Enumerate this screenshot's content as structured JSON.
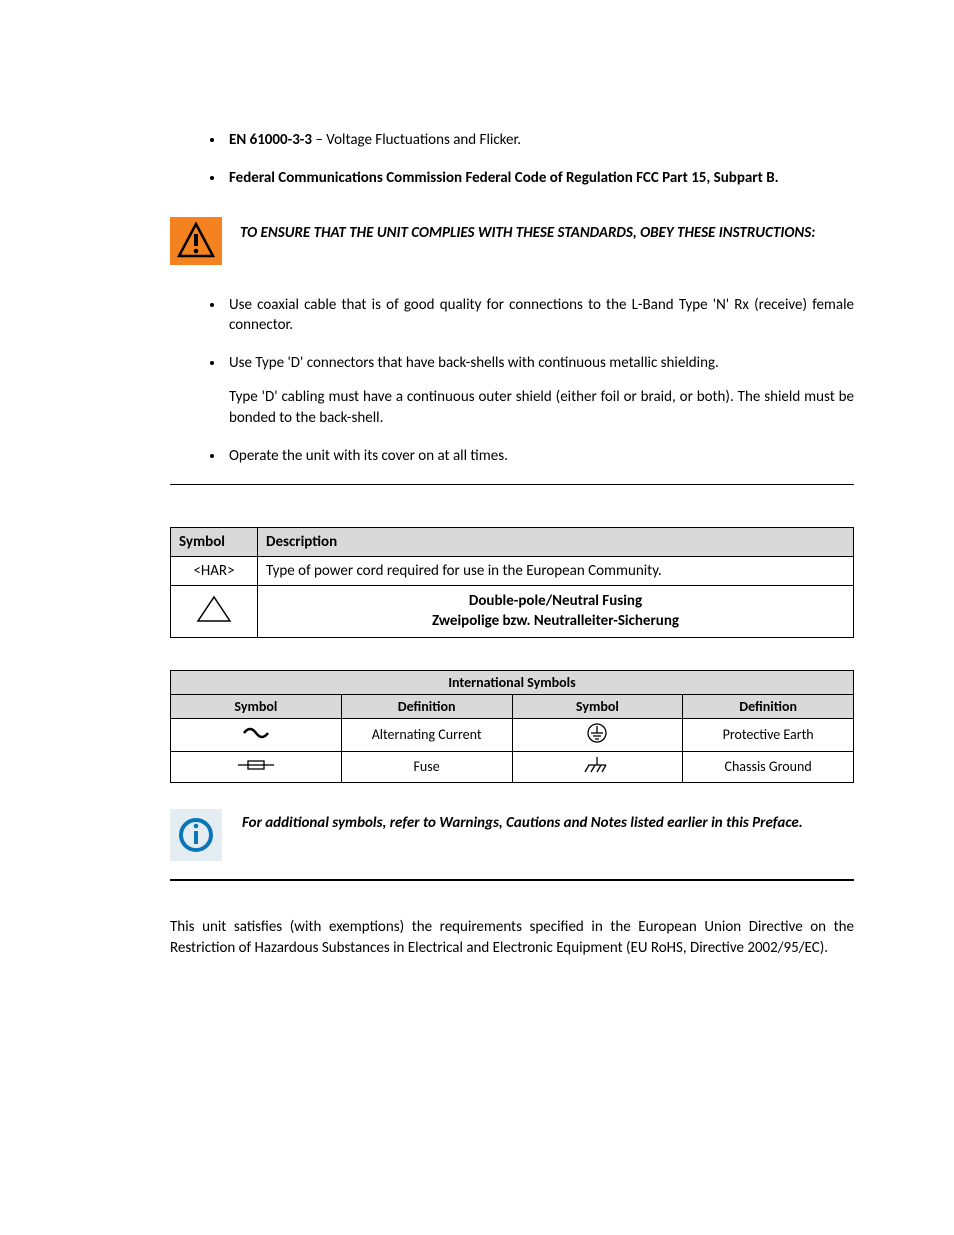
{
  "top_bullets": [
    {
      "bold": "EN 61000-3-3",
      "rest": " – Voltage Fluctuations and Flicker."
    },
    {
      "bold": "Federal Communications Commission Federal Code of Regulation FCC Part 15, Subpart B.",
      "rest": ""
    }
  ],
  "warning_text": "TO ENSURE THAT THE UNIT COMPLIES WITH THESE STANDARDS, OBEY THESE INSTRUCTIONS:",
  "mid_bullets": [
    {
      "main": "Use coaxial cable that is of good quality for connections to the L-Band Type 'N' Rx (receive) female connector.",
      "sub": null
    },
    {
      "main": "Use Type 'D' connectors that have back-shells with continuous metallic shielding.",
      "sub": "Type 'D' cabling must have a continuous outer shield (either foil or braid, or both). The shield must be bonded to the back-shell."
    },
    {
      "main": "Operate the unit with its cover on at all times.",
      "sub": null
    }
  ],
  "sym_table": {
    "headers": [
      "Symbol",
      "Description"
    ],
    "rows": [
      {
        "symbol_text": "<HAR>",
        "desc": "Type of power cord required for use in the European Community."
      },
      {
        "symbol_text": null,
        "desc_lines": [
          "Double-pole/Neutral Fusing",
          "Zweipolige bzw. Neutralleiter-Sicherung"
        ]
      }
    ]
  },
  "intl_table": {
    "title": "International Symbols",
    "headers": [
      "Symbol",
      "Definition",
      "Symbol",
      "Definition"
    ],
    "rows": [
      {
        "def1": "Alternating Current",
        "def2": "Protective Earth"
      },
      {
        "def1": "Fuse",
        "def2": "Chassis Ground"
      }
    ]
  },
  "info_text": "For additional symbols, refer to Warnings, Cautions and Notes listed earlier in this Preface.",
  "body_para": "This unit satisfies (with exemptions) the requirements specified in the European Union Directive on the Restriction of Hazardous Substances in Electrical and Electronic Equipment (EU RoHS, Directive 2002/95/EC)."
}
